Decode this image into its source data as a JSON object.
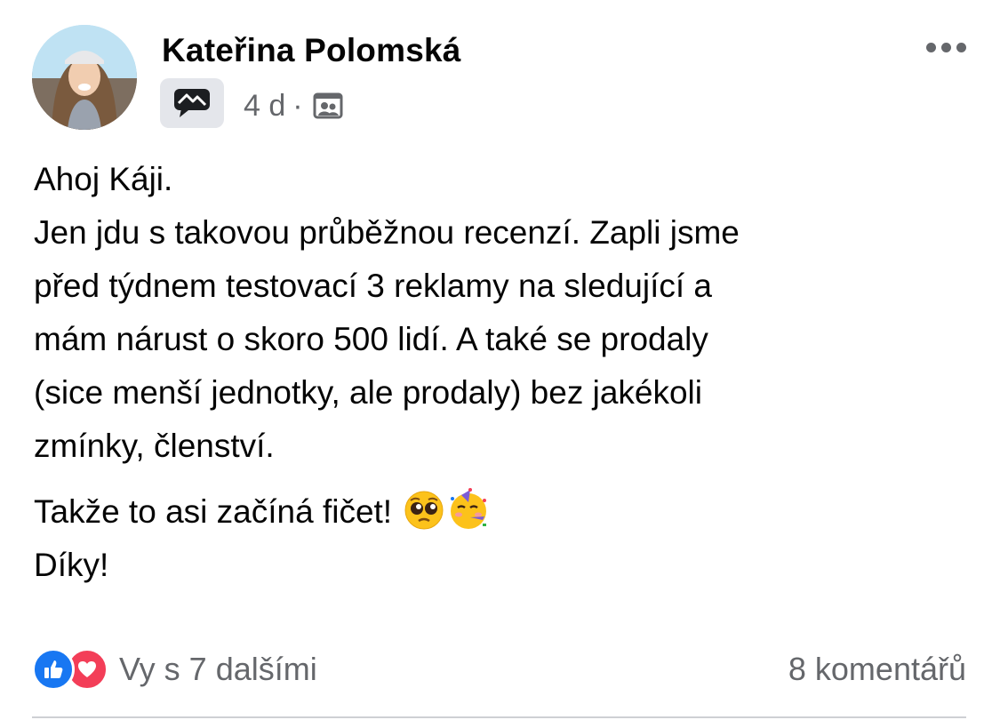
{
  "post": {
    "author": "Kateřina Polomská",
    "time": "4 d",
    "separator": "·",
    "body_lines": [
      "Ahoj Káji.",
      "Jen jdu s takovou průběžnou recenzí. Zapli jsme",
      "před týdnem testovací 3 reklamy na sledující a",
      "mám nárust o skoro 500 lidí. A také se prodaly",
      "(sice menší jednotky, ale prodaly) bez jakékoli",
      "zmínky, členství."
    ],
    "closing_text": "Takže to asi začíná fičet!",
    "sign_off": "Díky!"
  },
  "icons": {
    "badge": "speech-bubble-icon",
    "privacy": "members-icon",
    "more": "more-icon",
    "emoji_1": "pleading-face-emoji",
    "emoji_2": "partying-face-emoji",
    "like": "like-icon",
    "love": "love-icon"
  },
  "footer": {
    "reactions_text": "Vy s 7 dalšími",
    "comments_text": "8 komentářů"
  },
  "colors": {
    "text": "#050505",
    "secondary": "#65676b",
    "like": "#1877f2",
    "love": "#f33e58"
  }
}
